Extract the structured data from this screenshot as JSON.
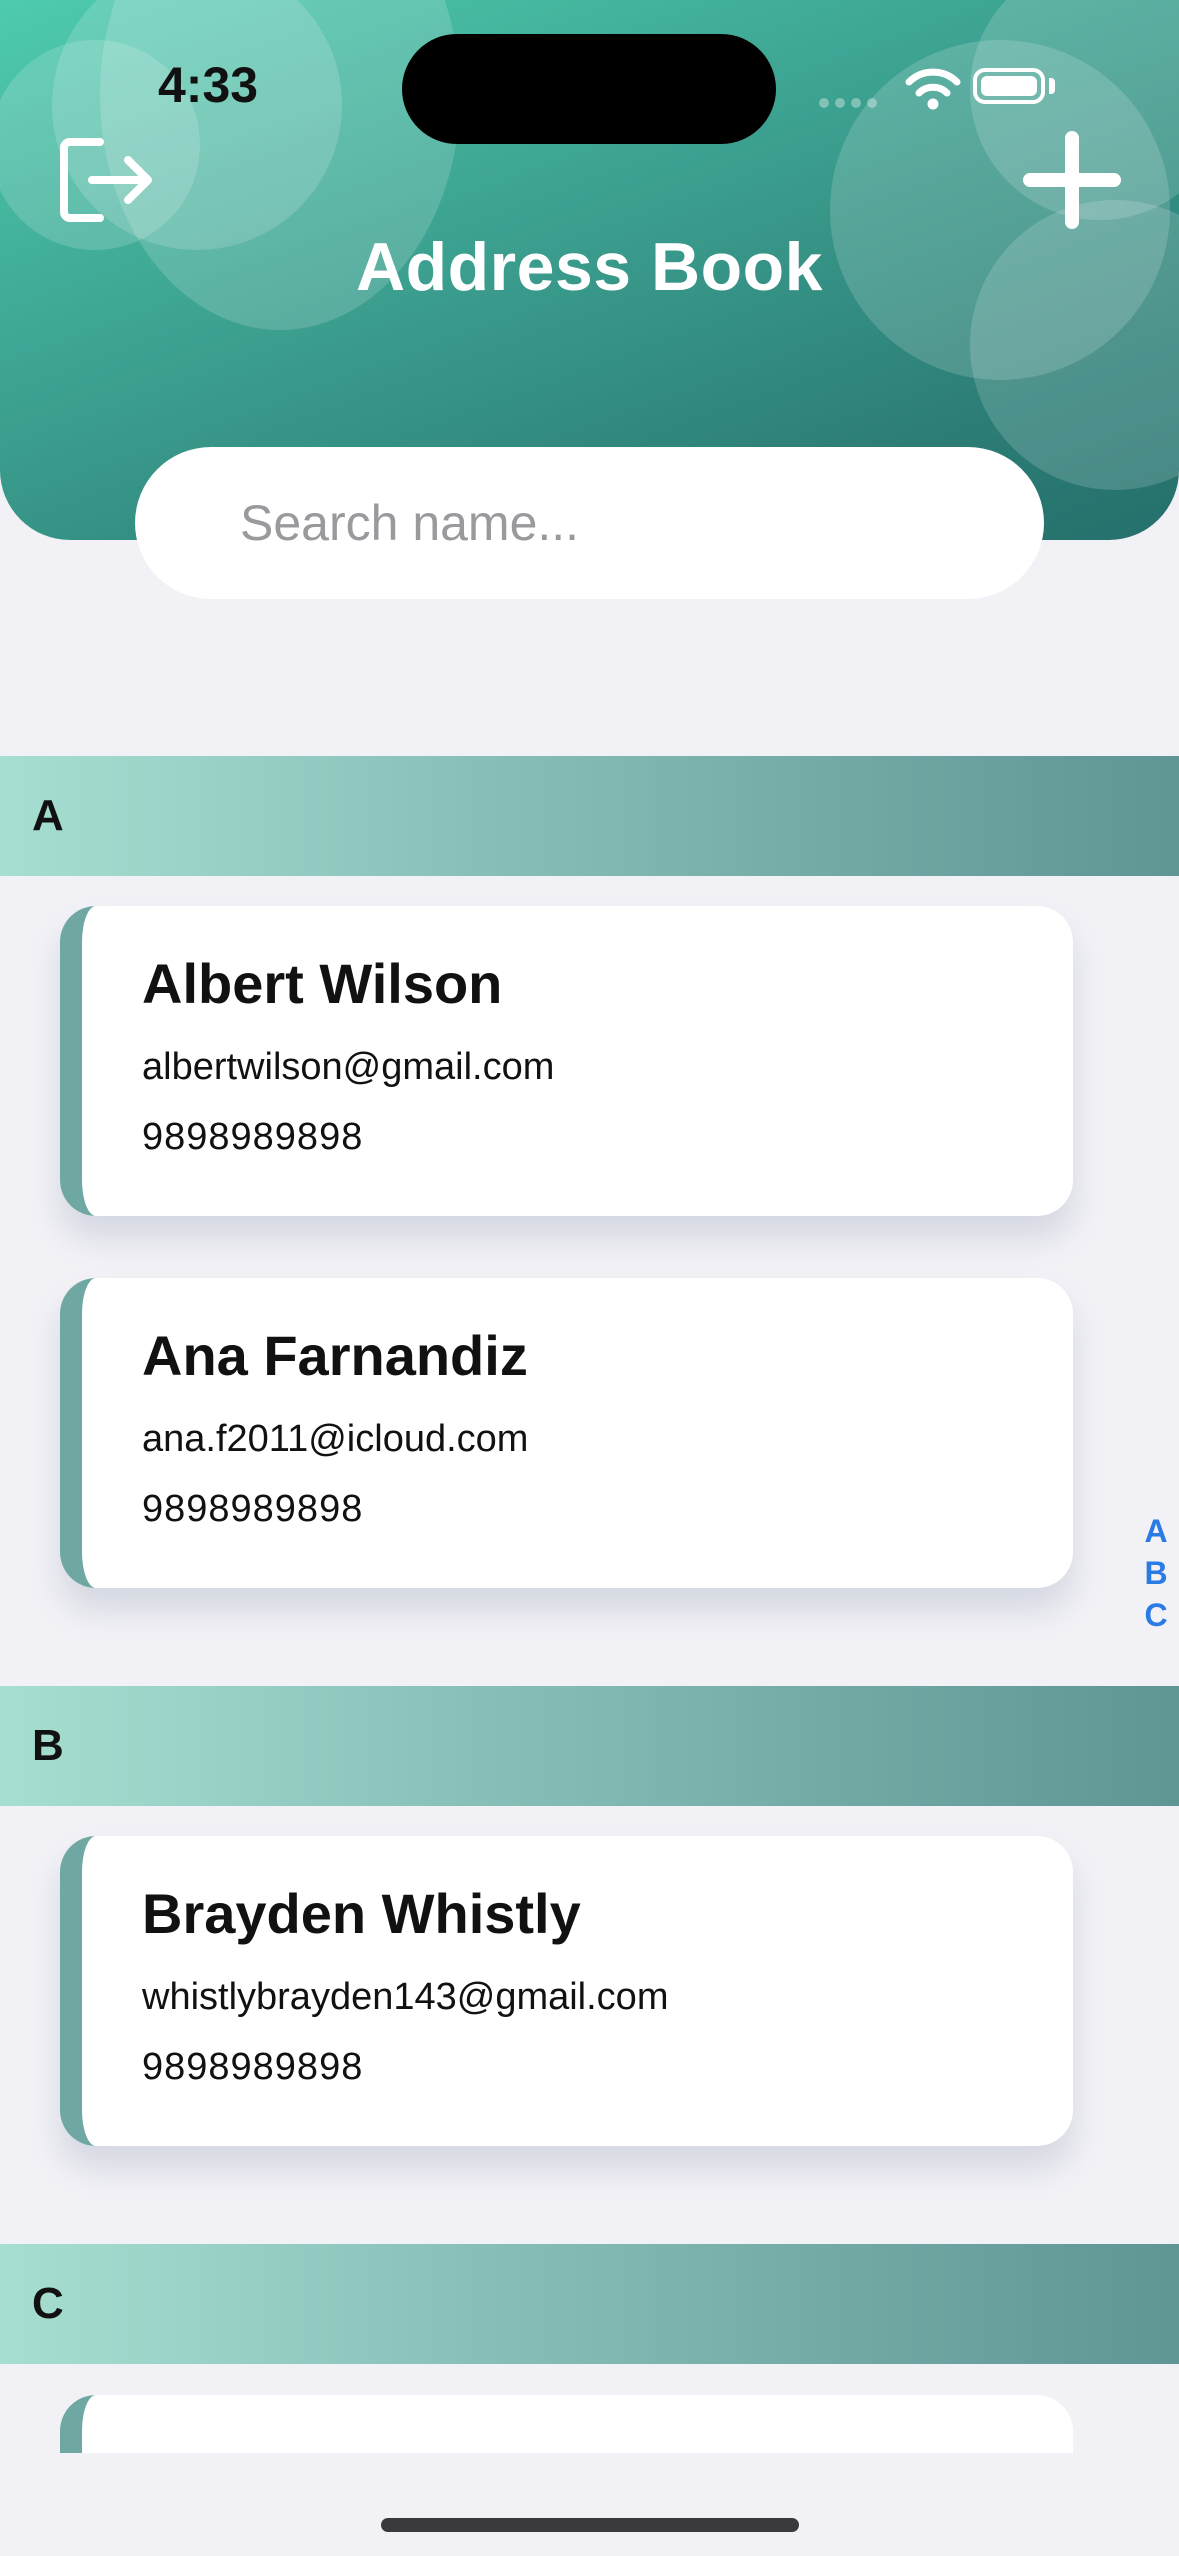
{
  "status_bar": {
    "time": "4:33"
  },
  "header": {
    "title": "Address Book",
    "logout_icon": "logout-icon",
    "add_icon": "plus-icon",
    "gradient": [
      "#4ecbae",
      "#25706c"
    ]
  },
  "search": {
    "placeholder": "Search name...",
    "value": ""
  },
  "sections": [
    {
      "letter": "A",
      "contacts": [
        {
          "name": "Albert Wilson",
          "email": "albertwilson@gmail.com",
          "phone": "9898989898"
        },
        {
          "name": "Ana Farnandiz",
          "email": "ana.f2011@icloud.com",
          "phone": "9898989898"
        }
      ]
    },
    {
      "letter": "B",
      "contacts": [
        {
          "name": "Brayden Whistly",
          "email": "whistlybrayden143@gmail.com",
          "phone": "9898989898"
        }
      ]
    },
    {
      "letter": "C"
    }
  ],
  "index_letters": [
    "A",
    "B",
    "C"
  ],
  "colors": {
    "accent_bar": "#6fa8a3",
    "index_blue": "#2b7be5",
    "background": "#f1f1f6"
  }
}
